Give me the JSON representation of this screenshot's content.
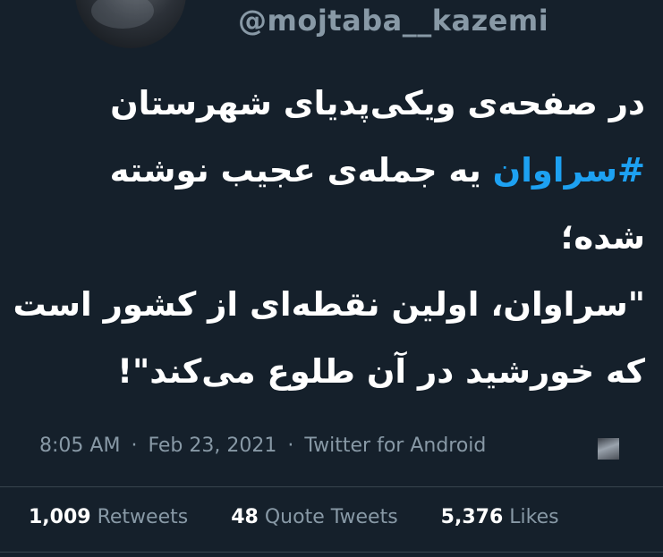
{
  "author": {
    "handle": "@mojtaba__kazemi"
  },
  "tweet": {
    "line1": "در صفحه‌ی ویکی‌پدیای شهرستان",
    "hashtag": "#سراوان",
    "line2_rest": " یه جمله‌ی عجیب نوشته",
    "line3": "شده؛",
    "line4": "\"سراوان، اولین نقطه‌ای از کشور است",
    "line5": "که خورشید در آن طلوع می‌کند\"!"
  },
  "meta": {
    "time": "8:05 AM",
    "separator1": "·",
    "date": "Feb 23, 2021",
    "separator2": "·",
    "source": "Twitter for Android"
  },
  "stats": {
    "retweets_count": "1,009",
    "retweets_label": "Retweets",
    "quotes_count": "48",
    "quotes_label": "Quote Tweets",
    "likes_count": "5,376",
    "likes_label": "Likes"
  },
  "colors": {
    "background": "#15202b",
    "text": "#ffffff",
    "secondary": "#8899a6",
    "hashtag": "#1da1f2",
    "divider": "#38444d"
  }
}
